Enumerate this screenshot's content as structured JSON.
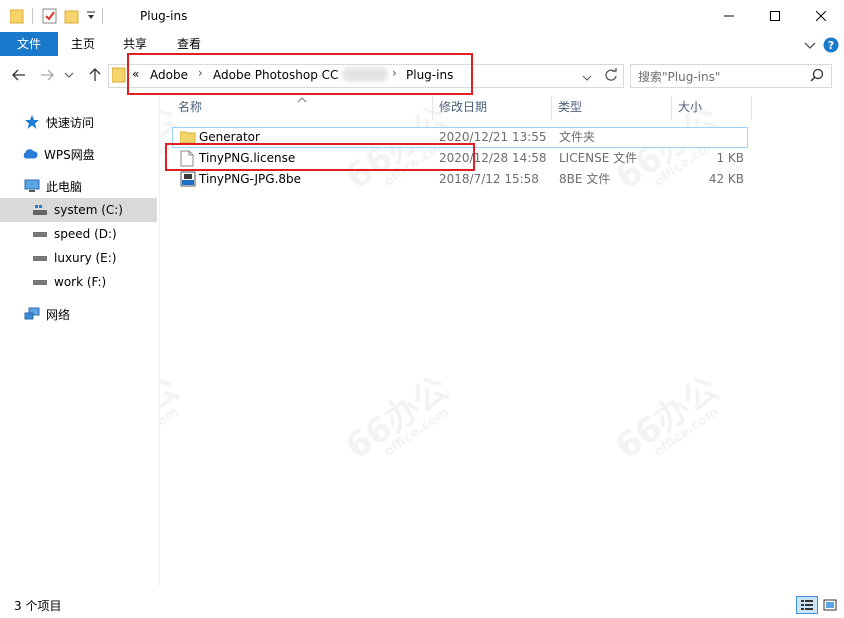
{
  "window": {
    "title": "Plug-ins",
    "controls": [
      "minimize-icon",
      "maximize-icon",
      "close-icon"
    ]
  },
  "ribbon": {
    "tabs": [
      {
        "label": "文件"
      },
      {
        "label": "主页"
      },
      {
        "label": "共享"
      },
      {
        "label": "查看"
      }
    ]
  },
  "address": {
    "overflow": "«",
    "crumbs": [
      "Adobe",
      "Adobe Photoshop CC",
      "Plug-ins"
    ],
    "search_placeholder": "搜索\"Plug-ins\""
  },
  "navpane": {
    "quick_access": "快速访问",
    "wps_drive": "WPS网盘",
    "this_pc": "此电脑",
    "drives": [
      {
        "label": "system (C:)"
      },
      {
        "label": "speed (D:)"
      },
      {
        "label": "luxury (E:)"
      },
      {
        "label": "work (F:)"
      }
    ],
    "network": "网络"
  },
  "columns": {
    "name": "名称",
    "modified": "修改日期",
    "type": "类型",
    "size": "大小"
  },
  "files": [
    {
      "name": "Generator",
      "modified": "2020/12/21 13:55",
      "type": "文件夹",
      "size": "",
      "icon": "folder-icon"
    },
    {
      "name": "TinyPNG.license",
      "modified": "2020/12/28 14:58",
      "type": "LICENSE 文件",
      "size": "1 KB",
      "icon": "document-icon"
    },
    {
      "name": "TinyPNG-JPG.8be",
      "modified": "2018/7/12 15:58",
      "type": "8BE 文件",
      "size": "42 KB",
      "icon": "plugin-icon"
    }
  ],
  "status": {
    "item_count": "3 个项目"
  },
  "colors": {
    "accent": "#1979ca",
    "highlight_red": "#e02020",
    "selection": "#d9d9d9"
  }
}
